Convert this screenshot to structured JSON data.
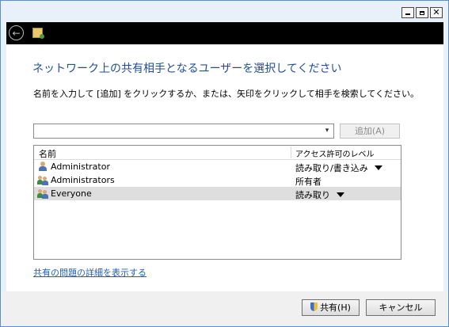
{
  "titlebar": {
    "minimize": "",
    "maximize": "",
    "close": "✕"
  },
  "nav": {
    "back_glyph": "←"
  },
  "dialog": {
    "heading": "ネットワーク上の共有相手となるユーザーを選択してください",
    "instruction": "名前を入力して [追加] をクリックするか、または、矢印をクリックして相手を検索してください。",
    "combo_value": "",
    "add_button": "追加(A)",
    "table": {
      "col_name": "名前",
      "col_level": "アクセス許可のレベル",
      "rows": [
        {
          "name": "Administrator",
          "level": "読み取り/書き込み",
          "icon": "user-icon",
          "dropdown": true
        },
        {
          "name": "Administrators",
          "level": "所有者",
          "icon": "group-icon",
          "dropdown": false
        },
        {
          "name": "Everyone",
          "level": "読み取り",
          "icon": "group-icon",
          "dropdown": true
        }
      ]
    },
    "help_link": "共有の問題の詳細を表示する"
  },
  "footer": {
    "share_button": "共有(H)",
    "cancel_button": "キャンセル"
  },
  "colors": {
    "heading": "#1f4e9a",
    "link": "#1f5fbf",
    "frame": "#5a8fc7"
  }
}
